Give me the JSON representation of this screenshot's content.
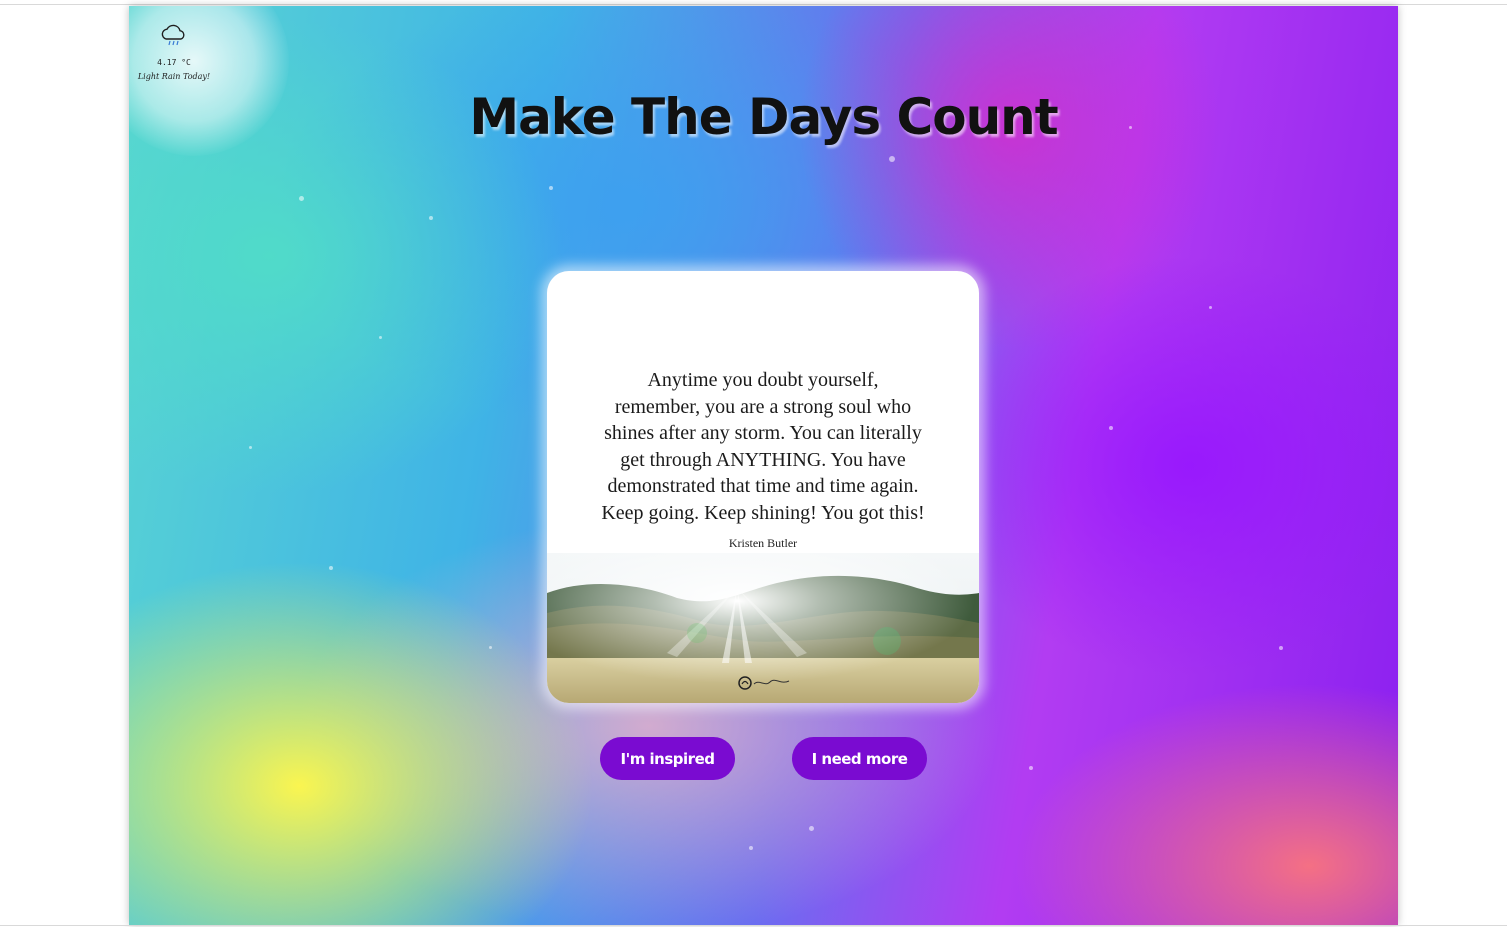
{
  "weather": {
    "icon": "cloud-rain-icon",
    "temperature": "4.17 °C",
    "description": "Light Rain Today!"
  },
  "headline": "Make The Days Count",
  "quote_card": {
    "lines": [
      "Anytime you doubt yourself,",
      "remember, you are a strong soul who",
      "shines after any storm. You can literally",
      "get through ANYTHING. You have",
      "demonstrated that time and time again.",
      "Keep going. Keep shining! You got this!"
    ],
    "author": "Kristen Butler"
  },
  "buttons": {
    "inspired_label": "I'm inspired",
    "more_label": "I need more"
  },
  "colors": {
    "button_bg": "#7a0bd1",
    "button_text": "#ffffff",
    "headline": "#111111"
  }
}
